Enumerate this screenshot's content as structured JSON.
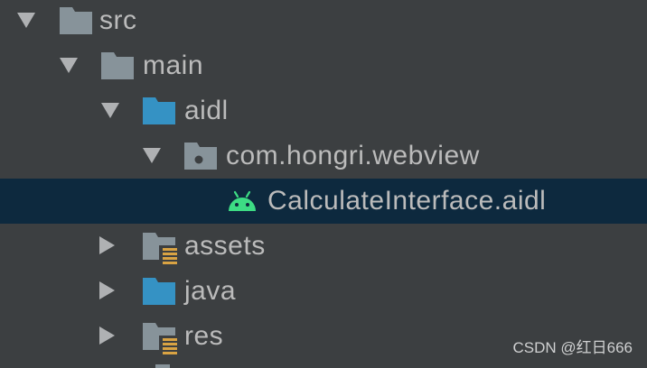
{
  "tree": {
    "src": {
      "label": "src"
    },
    "main": {
      "label": "main"
    },
    "aidl": {
      "label": "aidl"
    },
    "package": {
      "label": "com.hongri.webview"
    },
    "file": {
      "label": "CalculateInterface.aidl"
    },
    "assets": {
      "label": "assets"
    },
    "java": {
      "label": "java"
    },
    "res": {
      "label": "res"
    }
  },
  "icons": {
    "folder_plain": "folder-icon",
    "folder_source": "source-folder-icon",
    "folder_package": "package-folder-icon",
    "folder_resource": "resource-folder-icon",
    "android": "android-icon",
    "expand": "chevron-down-icon",
    "collapse": "chevron-right-icon"
  },
  "colors": {
    "background": "#3c3f41",
    "selection": "#0d293e",
    "text": "#bbbbbb",
    "folder_gray": "#87939a",
    "folder_blue": "#3592c4",
    "android_green": "#3ddc84",
    "resource_bars": "#d9a343"
  },
  "watermark": "CSDN @红日666"
}
